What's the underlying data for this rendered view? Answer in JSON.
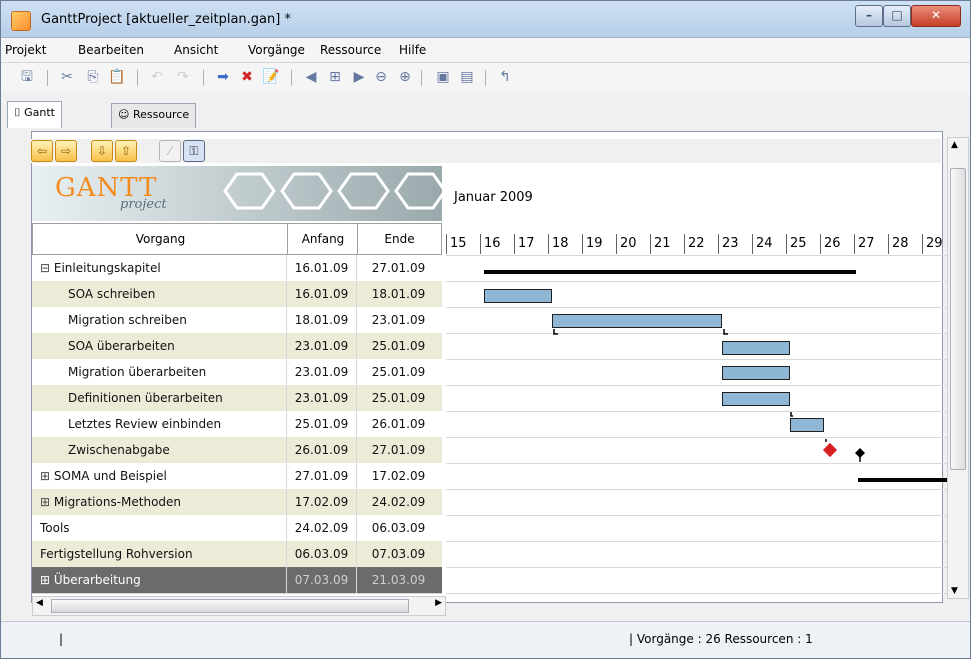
{
  "window": {
    "title": "GanttProject [aktueller_zeitplan.gan] *"
  },
  "menu": [
    "Projekt",
    "Bearbeiten",
    "Ansicht",
    "Vorgänge",
    "Ressource",
    "Hilfe"
  ],
  "tabs": [
    {
      "label": "Gantt"
    },
    {
      "label": "Ressource"
    }
  ],
  "toolbar": {
    "icons": [
      "save-icon",
      "cut-icon",
      "copy-icon",
      "paste-icon",
      "undo-icon",
      "redo-icon",
      "indent-icon",
      "delete-icon",
      "new-task-icon",
      "previous-icon",
      "zoom-fit-icon",
      "next-icon",
      "zoom-out-icon",
      "zoom-in-icon",
      "preview-icon",
      "export-icon",
      "layout-icon"
    ]
  },
  "nav_icons": [
    "left-arrow",
    "right-arrow",
    "down-arrow",
    "up-arrow",
    "unlink",
    "link"
  ],
  "logo": {
    "name": "GANTT",
    "sub": "project"
  },
  "table": {
    "headers": {
      "task": "Vorgang",
      "start": "Anfang",
      "end": "Ende"
    },
    "rows": [
      {
        "name": "Einleitungskapitel",
        "start": "16.01.09",
        "end": "27.01.09",
        "level": 0,
        "expand": "minus"
      },
      {
        "name": "SOA schreiben",
        "start": "16.01.09",
        "end": "18.01.09",
        "level": 1
      },
      {
        "name": "Migration schreiben",
        "start": "18.01.09",
        "end": "23.01.09",
        "level": 1
      },
      {
        "name": "SOA überarbeiten",
        "start": "23.01.09",
        "end": "25.01.09",
        "level": 1
      },
      {
        "name": "Migration überarbeiten",
        "start": "23.01.09",
        "end": "25.01.09",
        "level": 1
      },
      {
        "name": "Definitionen überarbeiten",
        "start": "23.01.09",
        "end": "25.01.09",
        "level": 1
      },
      {
        "name": "Letztes Review einbinden",
        "start": "25.01.09",
        "end": "26.01.09",
        "level": 1
      },
      {
        "name": "Zwischenabgabe",
        "start": "26.01.09",
        "end": "27.01.09",
        "level": 1
      },
      {
        "name": "SOMA und Beispiel",
        "start": "27.01.09",
        "end": "17.02.09",
        "level": 0,
        "expand": "plus"
      },
      {
        "name": "Migrations-Methoden",
        "start": "17.02.09",
        "end": "24.02.09",
        "level": 0,
        "expand": "plus"
      },
      {
        "name": "Tools",
        "start": "24.02.09",
        "end": "06.03.09",
        "level": 0
      },
      {
        "name": "Fertigstellung Rohversion",
        "start": "06.03.09",
        "end": "07.03.09",
        "level": 0
      },
      {
        "name": "Überarbeitung",
        "start": "07.03.09",
        "end": "21.03.09",
        "level": 0,
        "expand": "plus",
        "selected": true
      }
    ]
  },
  "timeline": {
    "month": "Januar 2009",
    "days": [
      "15",
      "16",
      "17",
      "18",
      "19",
      "20",
      "21",
      "22",
      "23",
      "24",
      "25",
      "26",
      "27",
      "28",
      "29"
    ]
  },
  "status": {
    "left": "|",
    "text": "| Vorgänge : 26  Ressourcen : 1"
  }
}
